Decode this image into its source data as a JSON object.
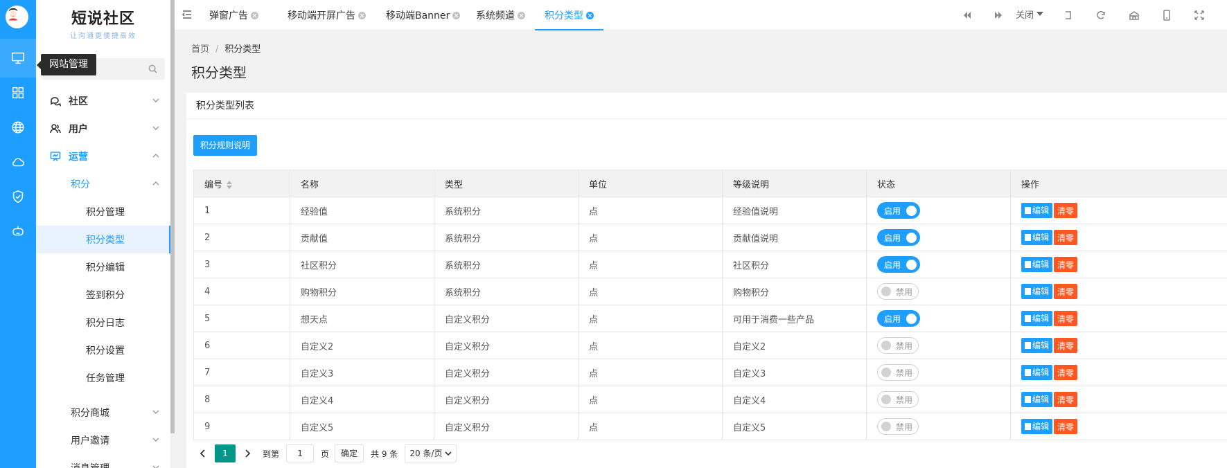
{
  "app": {
    "logo_title": "短说社区",
    "logo_slogan": "让沟通更便捷高效",
    "tooltip": "网站管理"
  },
  "colors": {
    "primary": "#1e9fff",
    "danger": "#ff5722",
    "pager_active": "#009688"
  },
  "rail_icons": [
    "monitor-icon",
    "apps-icon",
    "globe-icon",
    "cloud-icon",
    "shield-check-icon",
    "robot-icon"
  ],
  "menu": {
    "community": "社区",
    "user": "用户",
    "operation": "运营",
    "points": "积分",
    "points_items": [
      "积分管理",
      "积分类型",
      "积分编辑",
      "签到积分",
      "积分日志",
      "积分设置",
      "任务管理"
    ],
    "mall": "积分商城",
    "invite": "用户邀请",
    "message": "消息管理"
  },
  "tabs": [
    {
      "label": "弹窗广告"
    },
    {
      "label": "移动端开屏广告"
    },
    {
      "label": "移动端Banner"
    },
    {
      "label": "系统频道"
    },
    {
      "label": "积分类型"
    }
  ],
  "topbar": {
    "close_label": "关闭"
  },
  "breadcrumb": {
    "home": "首页",
    "sep": "/",
    "current": "积分类型"
  },
  "page": {
    "title": "积分类型",
    "card_title": "积分类型列表",
    "rule_button": "积分规则说明"
  },
  "table": {
    "headers": [
      "编号",
      "名称",
      "类型",
      "单位",
      "等级说明",
      "状态",
      "操作"
    ],
    "rows": [
      {
        "id": "1",
        "name": "经验值",
        "type": "系统积分",
        "unit": "点",
        "desc": "经验值说明",
        "status": "启用",
        "on": true
      },
      {
        "id": "2",
        "name": "贡献值",
        "type": "系统积分",
        "unit": "点",
        "desc": "贡献值说明",
        "status": "启用",
        "on": true
      },
      {
        "id": "3",
        "name": "社区积分",
        "type": "系统积分",
        "unit": "点",
        "desc": "社区积分",
        "status": "启用",
        "on": true
      },
      {
        "id": "4",
        "name": "购物积分",
        "type": "系统积分",
        "unit": "点",
        "desc": "购物积分",
        "status": "禁用",
        "on": false
      },
      {
        "id": "5",
        "name": "想天点",
        "type": "自定义积分",
        "unit": "点",
        "desc": "可用于消费一些产品",
        "status": "启用",
        "on": true
      },
      {
        "id": "6",
        "name": "自定义2",
        "type": "自定义积分",
        "unit": "点",
        "desc": "自定义2",
        "status": "禁用",
        "on": false
      },
      {
        "id": "7",
        "name": "自定义3",
        "type": "自定义积分",
        "unit": "点",
        "desc": "自定义3",
        "status": "禁用",
        "on": false
      },
      {
        "id": "8",
        "name": "自定义4",
        "type": "自定义积分",
        "unit": "点",
        "desc": "自定义4",
        "status": "禁用",
        "on": false
      },
      {
        "id": "9",
        "name": "自定义5",
        "type": "自定义积分",
        "unit": "点",
        "desc": "自定义5",
        "status": "禁用",
        "on": false
      }
    ],
    "edit_label": "编辑",
    "clear_label": "清零"
  },
  "pager": {
    "current": "1",
    "goto_label": "到第",
    "goto_value": "1",
    "page_unit": "页",
    "confirm": "确定",
    "total": "共 9 条",
    "page_size": "20 条/页"
  }
}
